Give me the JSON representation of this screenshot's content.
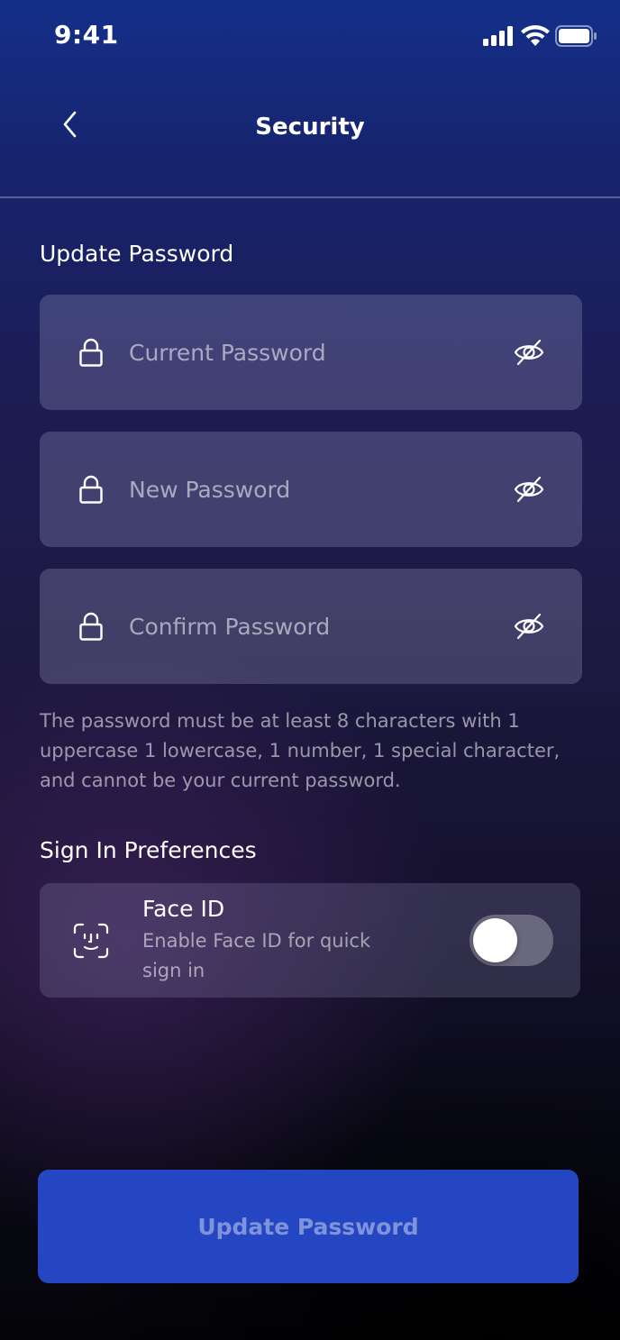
{
  "status_bar": {
    "time": "9:41"
  },
  "header": {
    "title": "Security",
    "back_icon": "chevron-left-icon"
  },
  "update_password": {
    "heading": "Update Password",
    "fields": [
      {
        "placeholder": "Current Password",
        "value": "",
        "icon": "lock-icon",
        "toggle_icon": "eye-off-icon"
      },
      {
        "placeholder": "New Password",
        "value": "",
        "icon": "lock-icon",
        "toggle_icon": "eye-off-icon"
      },
      {
        "placeholder": "Confirm Password",
        "value": "",
        "icon": "lock-icon",
        "toggle_icon": "eye-off-icon"
      }
    ],
    "helper": "The password must be at least 8 characters with 1 uppercase 1 lowercase, 1 number, 1 special character, and cannot be your current password."
  },
  "sign_in_preferences": {
    "heading": "Sign In Preferences",
    "face_id": {
      "title": "Face ID",
      "description": "Enable Face ID for quick sign in",
      "icon": "face-id-icon",
      "enabled": false
    }
  },
  "primary_button": {
    "label": "Update Password",
    "color": "#2446c2",
    "disabled": true
  }
}
